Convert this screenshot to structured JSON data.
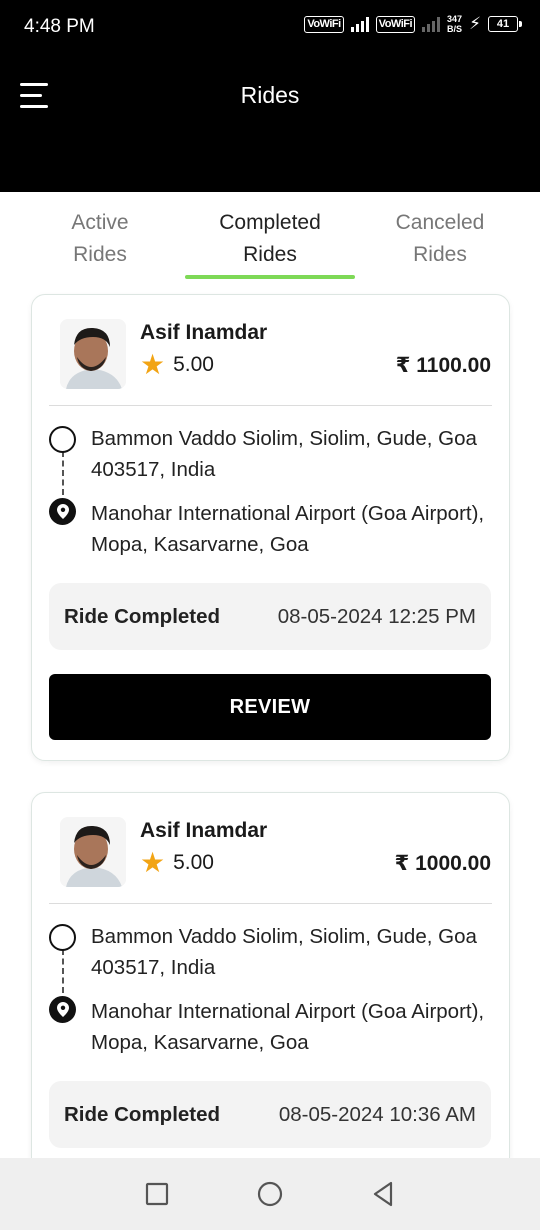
{
  "status_bar": {
    "time": "4:48 PM",
    "wifi_label_1": "VoWiFi",
    "wifi_label_2": "VoWiFi",
    "speed_value": "347",
    "speed_unit": "B/S",
    "battery": "41"
  },
  "header": {
    "title": "Rides",
    "menu_icon": "hamburger-menu-icon"
  },
  "tabs": [
    {
      "line1": "Active",
      "line2": "Rides",
      "active": false
    },
    {
      "line1": "Completed",
      "line2": "Rides",
      "active": true
    },
    {
      "line1": "Canceled",
      "line2": "Rides",
      "active": false
    }
  ],
  "rides": [
    {
      "driver_name": "Asif Inamdar",
      "rating": "5.00",
      "fare": "₹ 1100.00",
      "pickup": "Bammon Vaddo Siolim, Siolim, Gude, Goa 403517, India",
      "dropoff": "Manohar International Airport (Goa Airport), Mopa, Kasarvarne, Goa",
      "status_label": "Ride Completed",
      "status_time": "08-05-2024 12:25 PM",
      "action_label": "REVIEW"
    },
    {
      "driver_name": "Asif Inamdar",
      "rating": "5.00",
      "fare": "₹ 1000.00",
      "pickup": "Bammon Vaddo Siolim, Siolim, Gude, Goa 403517, India",
      "dropoff": "Manohar International Airport (Goa Airport), Mopa, Kasarvarne, Goa",
      "status_label": "Ride Completed",
      "status_time": "08-05-2024 10:36 AM"
    }
  ],
  "colors": {
    "header_bg": "#000000",
    "tab_indicator": "#7ed957",
    "star": "#f2a414",
    "button_bg": "#000000"
  },
  "nav_icons": [
    "recents-square-icon",
    "home-circle-icon",
    "back-triangle-icon"
  ]
}
